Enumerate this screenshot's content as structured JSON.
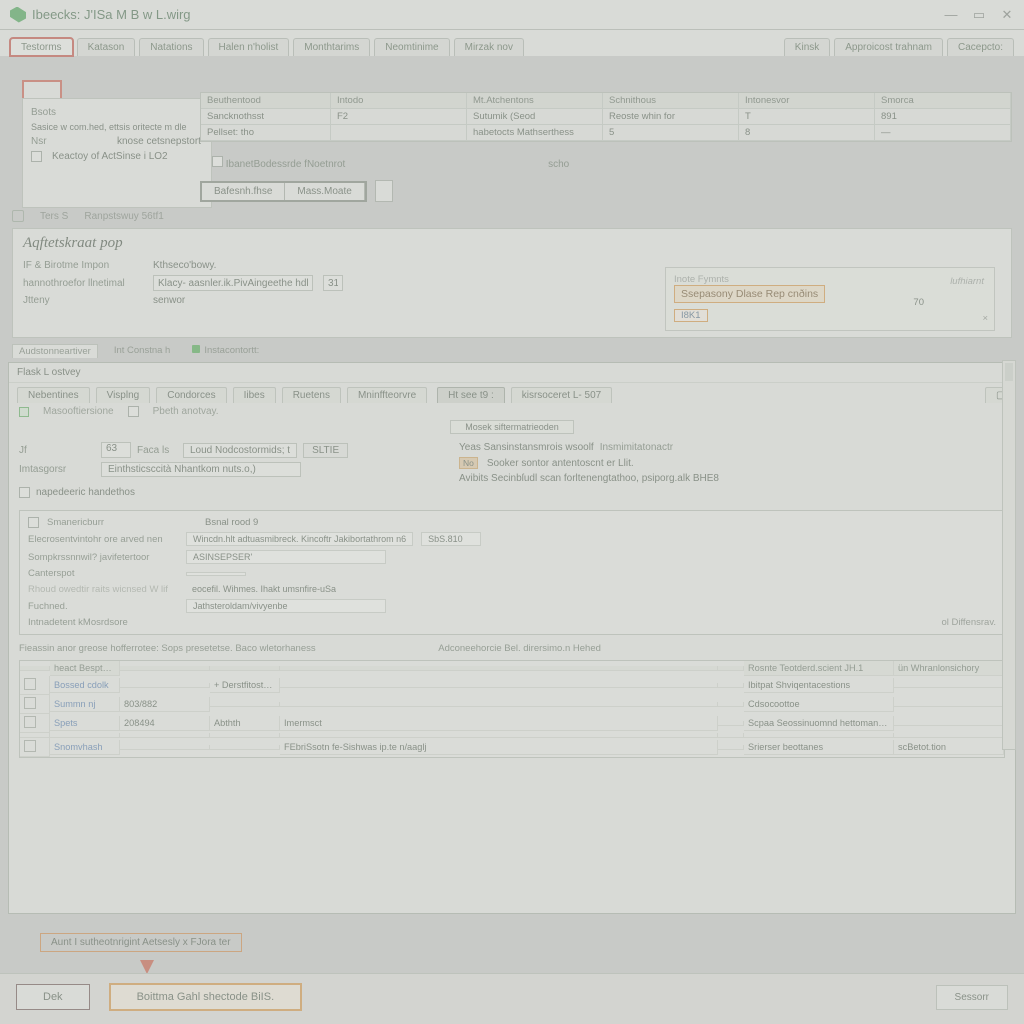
{
  "window": {
    "title": "Ibeecks: J'ISa M B w L.wirg"
  },
  "winbtns": {
    "min": "—",
    "max": "▭",
    "close": "✕"
  },
  "tabs": {
    "items": [
      "Testorms",
      "Katason",
      "Natations",
      "Halen n'holist",
      "Monthtarims",
      "Neomtinime",
      "Mirzak nov"
    ],
    "right": [
      "Kinsk",
      "Approicost trahnam",
      "Cacepcto:"
    ]
  },
  "headerLeft": {
    "line1_label": "Bsots",
    "line1_val": "Sasice w com.hed, ettsis oritecte m dle",
    "line2_label": "Nsr",
    "line2_val": "knose cetsnepstort",
    "line3_label": "",
    "line3_val": "Keactoy of ActSinse i LO2"
  },
  "hdrgrid": {
    "cols": [
      "Beuthentood",
      "Intodo",
      "",
      "",
      "",
      ""
    ],
    "row1": [
      "Sancknothsst",
      "F2",
      "Sutumik (Seod",
      "",
      "",
      ""
    ],
    "row2": [
      "Pellset: tho",
      "",
      "",
      "5",
      "",
      ""
    ],
    "right": {
      "colhead": [
        "Mt.Atchentons",
        "Schnithous",
        "Intonesvor",
        "Smorca"
      ],
      "r1": [
        "",
        "Reoste whin for",
        "T",
        "891"
      ],
      "r2": [
        "habetocts Mathserthess",
        "",
        "8",
        "—"
      ]
    }
  },
  "bandRow": {
    "l_label": "IbanetBodessrde  fNoetnrot",
    "l_sub": "scho",
    "btn1": "Bafesnh.fhse",
    "btn2": "Mass.Moate"
  },
  "meta": {
    "a": "Ters S",
    "b": "Ranpstswuy   56tf1"
  },
  "adj": {
    "title": "Aqftetskraat pop",
    "row1_lbl": "IF & Birotme Impon",
    "row1_val": "Kthseco'bowy.",
    "row2_lbl": "hannothroefor llnetimal",
    "row2_val": "Klacy- aasnler.ik.PivAingeethe hdl.loes",
    "row2_n": "31",
    "row3_lbl": "Jtteny",
    "row3_val": "senwor"
  },
  "hlcard": {
    "toplabel": "Inote   Fymnts",
    "title": "Ssepasony Dlase Rep cnðins",
    "idx": "I8K1",
    "rightword": "lufhiarnt",
    "num": "70",
    "close": "×"
  },
  "subtabs": [
    "Audstonneartiver",
    "Int Constna h",
    "Instacontortt:"
  ],
  "detail": {
    "title": "Flask L ostvey",
    "tabs": [
      "Nebentines",
      "Visplng",
      "Condorces",
      "Iibes",
      "Ruetens",
      "Mninffteorvre",
      "Ht see t9 :",
      "kisrsoceret  L- 507"
    ],
    "subA": "Masooftiersione",
    "subB": "Pbeth anotvay.",
    "smallbtn": "Mosek siftermatrieoden",
    "left": {
      "id_lbl": "Jf",
      "id_val": "63",
      "env_lbl": "Imtasgorsr",
      "sel_lbl": "Faca ls",
      "sel_val": "Loud Nodcostormids; t",
      "sel_btn": "SLTIE",
      "path_lbl": "",
      "path_val": "Einthsticsccità Nhantkom nuts.o,)",
      "chk1": "napedeeric handethos",
      "props_lbl": "Smanericburr",
      "props_sel": "Bsnal rood 9",
      "p1_k": "Elecrosentvintohr ore arved nen",
      "p1_v": "Wincdn.hlt adtuasmibreck. Kincoftr Jakibortathrom n6",
      "p2_k": "Sompkrssnnwil? javifetertoor",
      "p2_v": "ASINSEPSER'",
      "p3_k": "Canterspot",
      "p3_v": "",
      "p4_k": "Rhoud owedtir raits wicnsed W lif",
      "p4_v": "eocefil. Wihmes. Ihakt umsnfire-uSa",
      "p5_k": "Fuchned.",
      "p5_v": "Jathsteroldam/vivyenbe",
      "p6_k": "Intnadetent kMosrdsore",
      "p6_v": "",
      "p6_r": "ol  Diffensrav."
    },
    "right": {
      "line1_a": "Yeas Sansinstansmrois  wsoolf",
      "line1_b": "Insmimitatonactr",
      "chip": "No",
      "line2": "Sooker sontor antentoscnt er Llit.",
      "line3": "Avibits Secinbſudl scan forltenengtathoo, psiporg.alk BHE8"
    },
    "note": "Fieassin anor greose hofferrotee: Sops presetetse. Baco wletorhaness",
    "note2": "Adconeehorcie Bel. dirersimo.n Hehed",
    "table": {
      "head": [
        "",
        "heact Bespthmorsnus",
        "",
        "",
        "",
        "",
        "Rosnte Teotderd.scient  JH.1",
        "ün   Whranlonsichory"
      ],
      "rows": [
        [
          "",
          "Bossed cdolk",
          "",
          "+ Derstfitostscal",
          "",
          "",
          "Ibitpat Shviqentacestions",
          ""
        ],
        [
          "",
          "Summn nj",
          "803/882",
          "",
          "",
          "",
          "Cdsocoottoe",
          ""
        ],
        [
          "",
          "Spets",
          "208494",
          "Abthth",
          "  Imermsct",
          "",
          "Scpaa Seossinuomnd hettomananted Adrerts",
          ""
        ],
        [
          "",
          "",
          "",
          "",
          "",
          "",
          "",
          ""
        ],
        [
          "",
          "Snomvhash",
          "",
          "FEbriSsotn fe-Sishwas    ip.te  n/aaglj",
          "",
          "",
          "Srierser beottanes",
          "scBetot.tion"
        ]
      ]
    }
  },
  "chip": "Aunt I sutheotnrigint Aetsesly x   FJora ter",
  "bottom": {
    "ok": "Dek",
    "main": "Boittma Gahl shectode BiIS.",
    "right": "Sessorr"
  }
}
